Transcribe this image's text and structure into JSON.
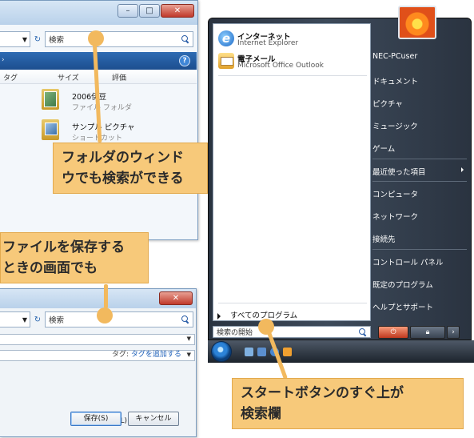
{
  "explorer": {
    "search_placeholder": "検索",
    "columns": [
      "タグ",
      "サイズ",
      "評価"
    ],
    "files": [
      {
        "name": "2006伊豆",
        "type": "ファイル フォルダ"
      },
      {
        "name": "サンプル ピクチャ",
        "type": "ショートカット"
      }
    ],
    "help_label": "?"
  },
  "save_dialog": {
    "search_placeholder": "検索",
    "tag_label": "タグ:",
    "tag_link": "タグを追加する",
    "tools_label": "ツール(L)",
    "save_label": "保存(S)",
    "cancel_label": "キャンセル"
  },
  "start_menu": {
    "pinned": [
      {
        "title": "インターネット",
        "subtitle": "Internet Explorer",
        "icon": "internet-explorer-icon"
      },
      {
        "title": "電子メール",
        "subtitle": "Microsoft Office Outlook",
        "icon": "mail-icon"
      }
    ],
    "all_programs": "すべてのプログラム",
    "search_placeholder": "検索の開始",
    "right_items": [
      "NEC-PCuser",
      "ドキュメント",
      "ピクチャ",
      "ミュージック",
      "ゲーム",
      "最近使った項目",
      "コンピュータ",
      "ネットワーク",
      "接続先",
      "コントロール パネル",
      "既定のプログラム",
      "ヘルプとサポート"
    ]
  },
  "callouts": {
    "folder": [
      "フォルダのウィンド",
      "ウでも検索ができる"
    ],
    "save": [
      "ファイルを保存する",
      "ときの画面でも"
    ],
    "start": [
      "スタートボタンのすぐ上が",
      "検索欄"
    ]
  },
  "colors": {
    "callout_bg": "#f7c97a",
    "callout_pointer": "#f2b95e",
    "vista_blue": "#1c4e8f",
    "start_menu_bg": "#2a3340"
  }
}
